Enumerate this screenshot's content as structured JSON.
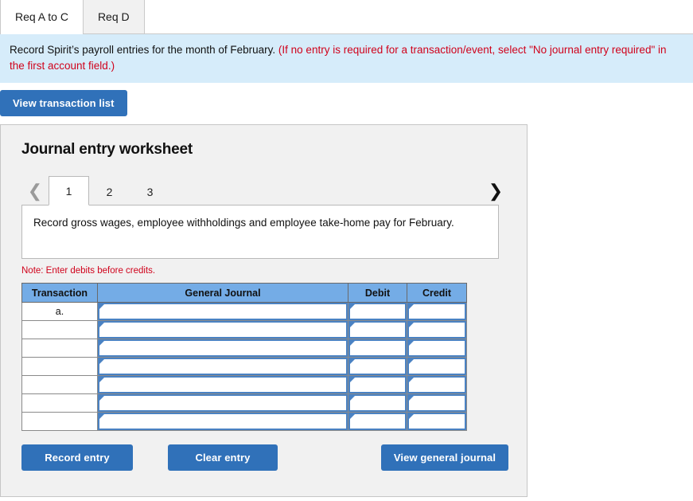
{
  "tabs": [
    {
      "label": "Req A to C",
      "active": true
    },
    {
      "label": "Req D",
      "active": false
    }
  ],
  "banner": {
    "text_black": "Record Spirit’s payroll entries for the month of February.",
    "text_red": "(If no entry is required for a transaction/event, select \"No journal entry required\" in the first account field.)",
    "bg_color": "#d6ecfa",
    "red_color": "#d0021b"
  },
  "toolbar": {
    "view_transaction_list_label": "View transaction list"
  },
  "worksheet": {
    "title": "Journal entry worksheet",
    "pager": {
      "prev_icon": "chevron-left-icon",
      "next_icon": "chevron-right-icon",
      "pages": [
        "1",
        "2",
        "3"
      ],
      "active_page": "1"
    },
    "description": "Record gross wages, employee withholdings and employee take-home pay for February.",
    "note": "Note: Enter debits before credits.",
    "table": {
      "headers": [
        "Transaction",
        "General Journal",
        "Debit",
        "Credit"
      ],
      "rows": [
        {
          "transaction": "a.",
          "general_journal": "",
          "debit": "",
          "credit": ""
        },
        {
          "transaction": "",
          "general_journal": "",
          "debit": "",
          "credit": ""
        },
        {
          "transaction": "",
          "general_journal": "",
          "debit": "",
          "credit": ""
        },
        {
          "transaction": "",
          "general_journal": "",
          "debit": "",
          "credit": ""
        },
        {
          "transaction": "",
          "general_journal": "",
          "debit": "",
          "credit": ""
        },
        {
          "transaction": "",
          "general_journal": "",
          "debit": "",
          "credit": ""
        },
        {
          "transaction": "",
          "general_journal": "",
          "debit": "",
          "credit": ""
        }
      ],
      "header_bg": "#74ace6"
    },
    "buttons": {
      "record_entry": "Record entry",
      "clear_entry": "Clear entry",
      "view_general_journal": "View general journal"
    }
  },
  "colors": {
    "button_blue": "#3071b9",
    "panel_bg": "#f1f1f1"
  }
}
